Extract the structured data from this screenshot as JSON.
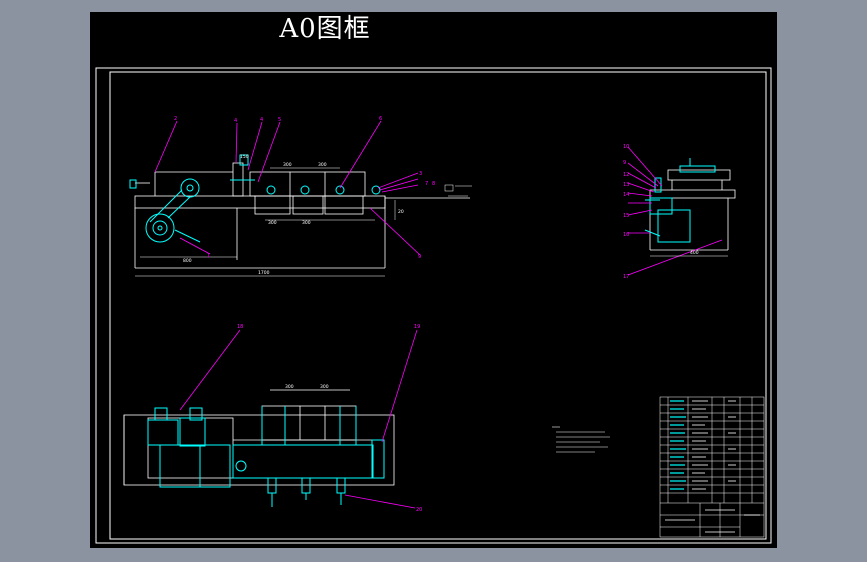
{
  "title": "A0图框",
  "colors": {
    "background": "#000000",
    "outer": "#8c93a0",
    "frame": "#ffffff",
    "part": "#00ffff",
    "leader": "#ff00ff",
    "dimension": "#ffffff"
  },
  "front_view": {
    "balloons": [
      "2",
      "4",
      "4",
      "5",
      "6",
      "3",
      "7",
      "8",
      "1",
      "9"
    ],
    "dims": [
      "300",
      "300",
      "150",
      "300",
      "300",
      "1700",
      "20",
      "800"
    ]
  },
  "side_view": {
    "balloons": [
      "10",
      "9",
      "12",
      "13",
      "14",
      "15",
      "16",
      "17"
    ],
    "dims": [
      "400"
    ]
  },
  "plan_view": {
    "balloons": [
      "18",
      "19",
      "20"
    ],
    "dims": [
      "300",
      "300"
    ]
  }
}
